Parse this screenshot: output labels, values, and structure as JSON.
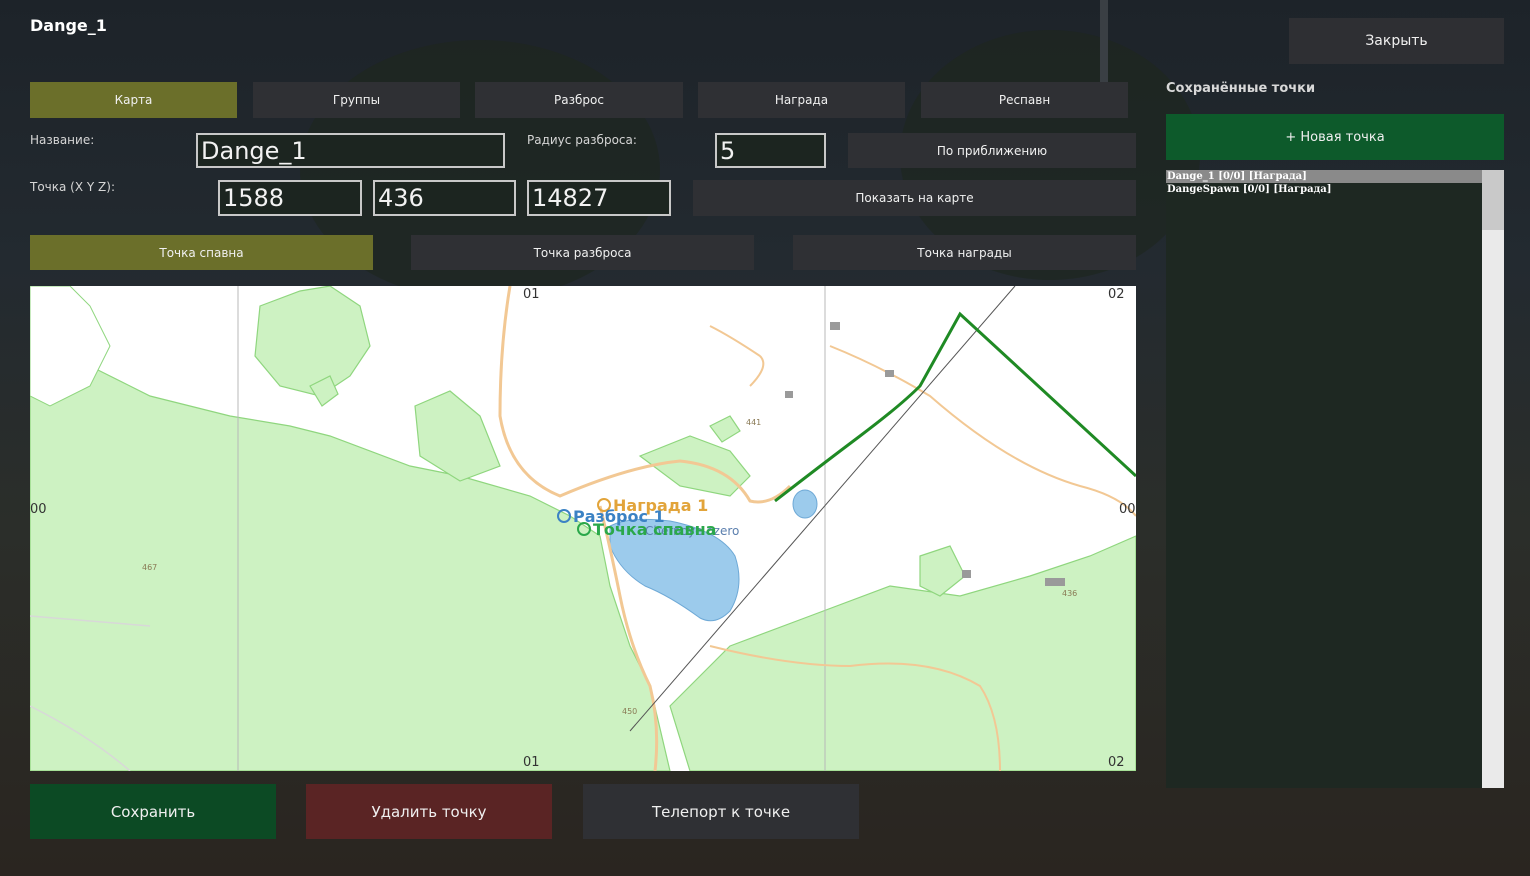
{
  "window": {
    "title": "Dange_1",
    "close_label": "Закрыть"
  },
  "tabs": [
    {
      "label": "Карта",
      "active": true
    },
    {
      "label": "Группы",
      "active": false
    },
    {
      "label": "Разброс",
      "active": false
    },
    {
      "label": "Награда",
      "active": false
    },
    {
      "label": "Респавн",
      "active": false
    }
  ],
  "form": {
    "name_label": "Название:",
    "name_value": "Dange_1",
    "radius_label": "Радиус разброса:",
    "radius_value": "5",
    "nearby_button": "По приближению",
    "point_label": "Точка (X Y Z):",
    "x_value": "1588",
    "y_value": "436",
    "z_value": "14827",
    "show_on_map_button": "Показать на карте"
  },
  "point_types": [
    {
      "label": "Точка спавна",
      "active": true
    },
    {
      "label": "Точка разброса",
      "active": false
    },
    {
      "label": "Точка награды",
      "active": false
    }
  ],
  "map": {
    "grid_top_left": "01",
    "grid_top_right": "02",
    "grid_bottom_left": "01",
    "grid_bottom_right": "02",
    "grid_left": "00",
    "grid_right": "00",
    "elev_467": "467",
    "elev_441": "441",
    "elev_436": "436",
    "elev_450": "450",
    "lake_name": "Chernoye ozero",
    "marker_reward": "Награда 1",
    "marker_spread": "Разброс 1",
    "marker_spawn": "Точка спавна",
    "colors": {
      "reward": "#e2a43a",
      "spread": "#3b82c4",
      "spawn": "#2aa84a",
      "forest": "#cdf2c2",
      "water": "#9ccbec"
    }
  },
  "saved": {
    "title": "Сохранённые точки",
    "new_point_button": "+ Новая точка",
    "items": [
      {
        "label": "Dange_1  [0/0]  [Награда]",
        "selected": true
      },
      {
        "label": "DangeSpawn  [0/0]  [Награда]",
        "selected": false
      }
    ]
  },
  "actions": {
    "save": "Сохранить",
    "delete": "Удалить точку",
    "teleport": "Телепорт к точке"
  },
  "colors": {
    "accent_olive": "#6b6f2a",
    "save_green": "#0c4a24",
    "delete_red": "#5a2424",
    "panel_gray": "#2f3034"
  }
}
